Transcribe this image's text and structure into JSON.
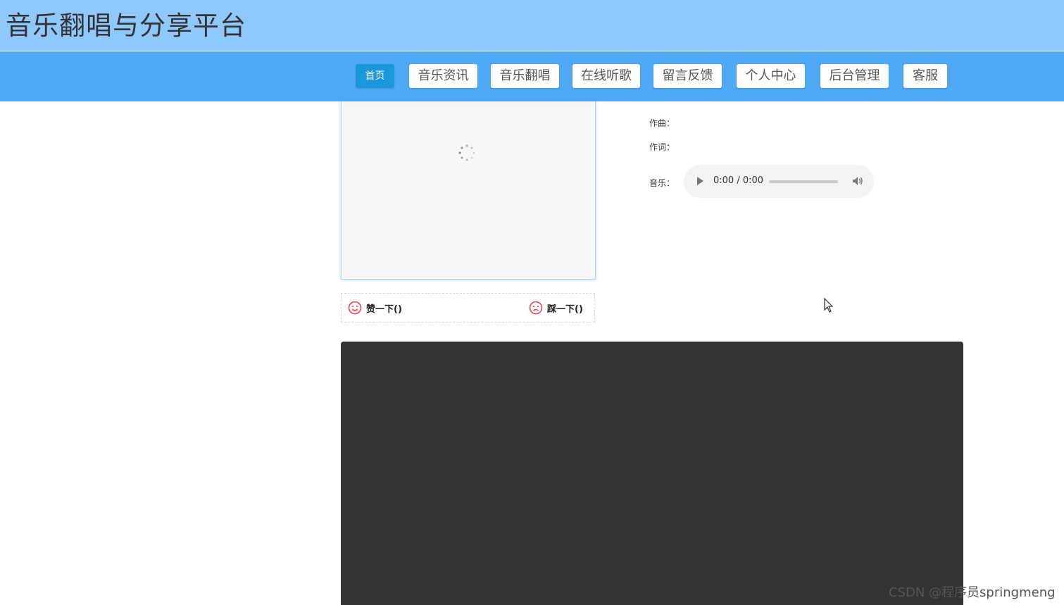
{
  "header": {
    "title": "音乐翻唱与分享平台"
  },
  "nav": {
    "items": [
      {
        "label": "首页",
        "active": true
      },
      {
        "label": "音乐资讯"
      },
      {
        "label": "音乐翻唱"
      },
      {
        "label": "在线听歌"
      },
      {
        "label": "留言反馈"
      },
      {
        "label": "个人中心"
      },
      {
        "label": "后台管理"
      },
      {
        "label": "客服"
      }
    ]
  },
  "vote": {
    "like_label": "赞一下()",
    "dislike_label": "踩一下()"
  },
  "song_info": {
    "composer_label": "作曲：",
    "lyricist_label": "作词：",
    "music_label": "音乐："
  },
  "audio_player": {
    "time": "0:00 / 0:00"
  },
  "watermark": "CSDN @程序员springmeng",
  "colors": {
    "header_bg": "#8ec8fd",
    "nav_bg": "#4fa9f7",
    "nav_active": "#1a96db",
    "video_bg": "#333333",
    "vote_icon": "#e5474b"
  }
}
